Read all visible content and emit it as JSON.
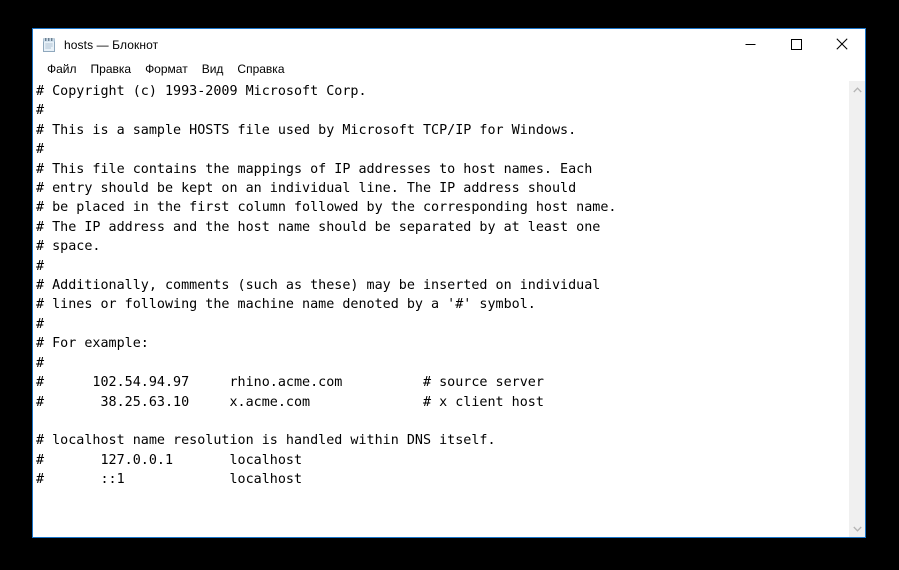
{
  "window": {
    "title": "hosts — Блокнот",
    "app_icon": "notepad-icon",
    "border_color": "#1a74c8",
    "background": "#ffffff"
  },
  "controls": {
    "minimize_label": "Свернуть",
    "maximize_label": "Развернуть",
    "close_label": "Закрыть"
  },
  "menu": {
    "items": [
      {
        "label": "Файл"
      },
      {
        "label": "Правка"
      },
      {
        "label": "Формат"
      },
      {
        "label": "Вид"
      },
      {
        "label": "Справка"
      }
    ]
  },
  "editor": {
    "lines": [
      "# Copyright (c) 1993-2009 Microsoft Corp.",
      "#",
      "# This is a sample HOSTS file used by Microsoft TCP/IP for Windows.",
      "#",
      "# This file contains the mappings of IP addresses to host names. Each",
      "# entry should be kept on an individual line. The IP address should",
      "# be placed in the first column followed by the corresponding host name.",
      "# The IP address and the host name should be separated by at least one",
      "# space.",
      "#",
      "# Additionally, comments (such as these) may be inserted on individual",
      "# lines or following the machine name denoted by a '#' symbol.",
      "#",
      "# For example:",
      "#",
      "#      102.54.94.97     rhino.acme.com          # source server",
      "#       38.25.63.10     x.acme.com              # x client host",
      "",
      "# localhost name resolution is handled within DNS itself.",
      "#       127.0.0.1       localhost",
      "#       ::1             localhost"
    ],
    "text_color": "#000000",
    "background": "#ffffff"
  },
  "scrollbar": {
    "up_arrow": "chevron-up-icon",
    "down_arrow": "chevron-down-icon",
    "track_color": "#f0f0f0",
    "position": "top"
  },
  "desktop": {
    "background": "#000000"
  }
}
